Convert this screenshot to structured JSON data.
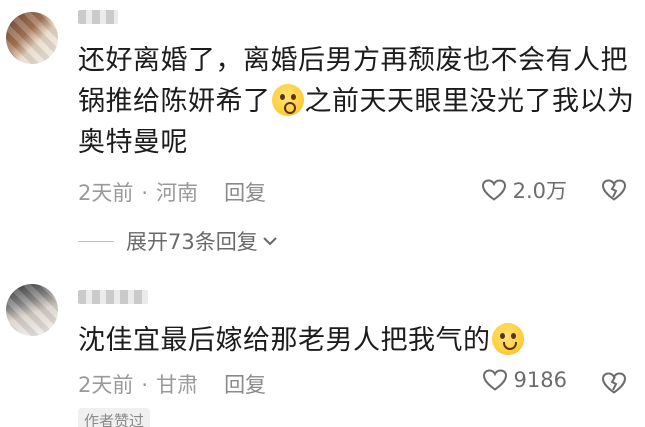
{
  "comments": [
    {
      "text_before_emoji": "还好离婚了，离婚后男方再颓废也不会有人把锅推给陈妍希了",
      "emoji": "scared-face-emoji",
      "text_after_emoji": "之前天天眼里没光了我以为奥特曼呢",
      "time": "2天前",
      "location": "河南",
      "reply_label": "回复",
      "likes": "2.0万",
      "expand_label": "展开73条回复"
    },
    {
      "text_before_emoji": "沈佳宜最后嫁给那老男人把我气的",
      "emoji": "smiling-face-emoji",
      "text_after_emoji": "",
      "time": "2天前",
      "location": "甘肃",
      "reply_label": "回复",
      "likes": "9186",
      "badge": "作者赞过"
    }
  ],
  "separator": "·",
  "colors": {
    "meta_text": "#9a9a9a",
    "body_text": "#1c1c1c",
    "background": "#ffffff"
  },
  "icons": [
    "heart-icon",
    "dislike-icon",
    "chevron-down-icon"
  ]
}
